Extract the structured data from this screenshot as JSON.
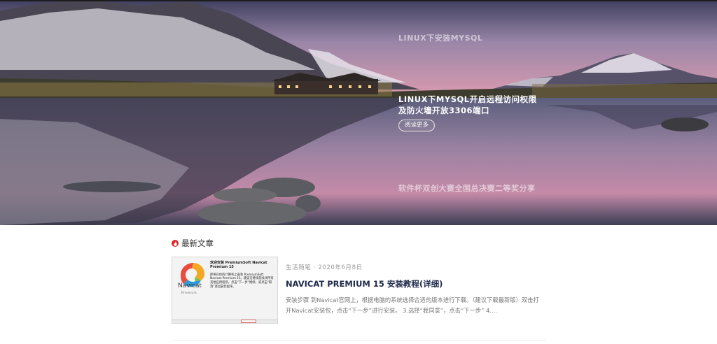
{
  "hero": {
    "slides": [
      {
        "title": "LINUX下安装MYSQL"
      },
      {
        "title": "LINUX下MYSQL开启远程访问权限及防火墙开放3306端口"
      },
      {
        "title": "软件杯双创大赛全国总决赛二等奖分享"
      }
    ],
    "read_more": "阅读更多"
  },
  "section": {
    "icon": "flame-icon",
    "title": "最新文章"
  },
  "posts": [
    {
      "category": "生活随笔",
      "separator": "·",
      "date": "2020年6月8日",
      "title": "NAVICAT PREMIUM 15 安装教程(详细)",
      "excerpt": "安装步骤 到Navicat官网上，根据电脑的系统选择合适的版本进行下载。（建议下载最新版）双击打开Navicat安装包，点击“下一步”进行安装。 3.选择“我同意”，点击“下一步” 4....",
      "thumbnail": {
        "heading": "欢迎安装 PremiumSoft Navicat Premium 15",
        "body": "即将在你的计算机上安装 PremiumSoft Navicat Premium 15。建议在继续前关闭所有其他应用程序。点击“下一步”继续，或点击“取消”退出安装程序。",
        "logo_text": "Navicat",
        "logo_sub": "Premium"
      }
    }
  ]
}
